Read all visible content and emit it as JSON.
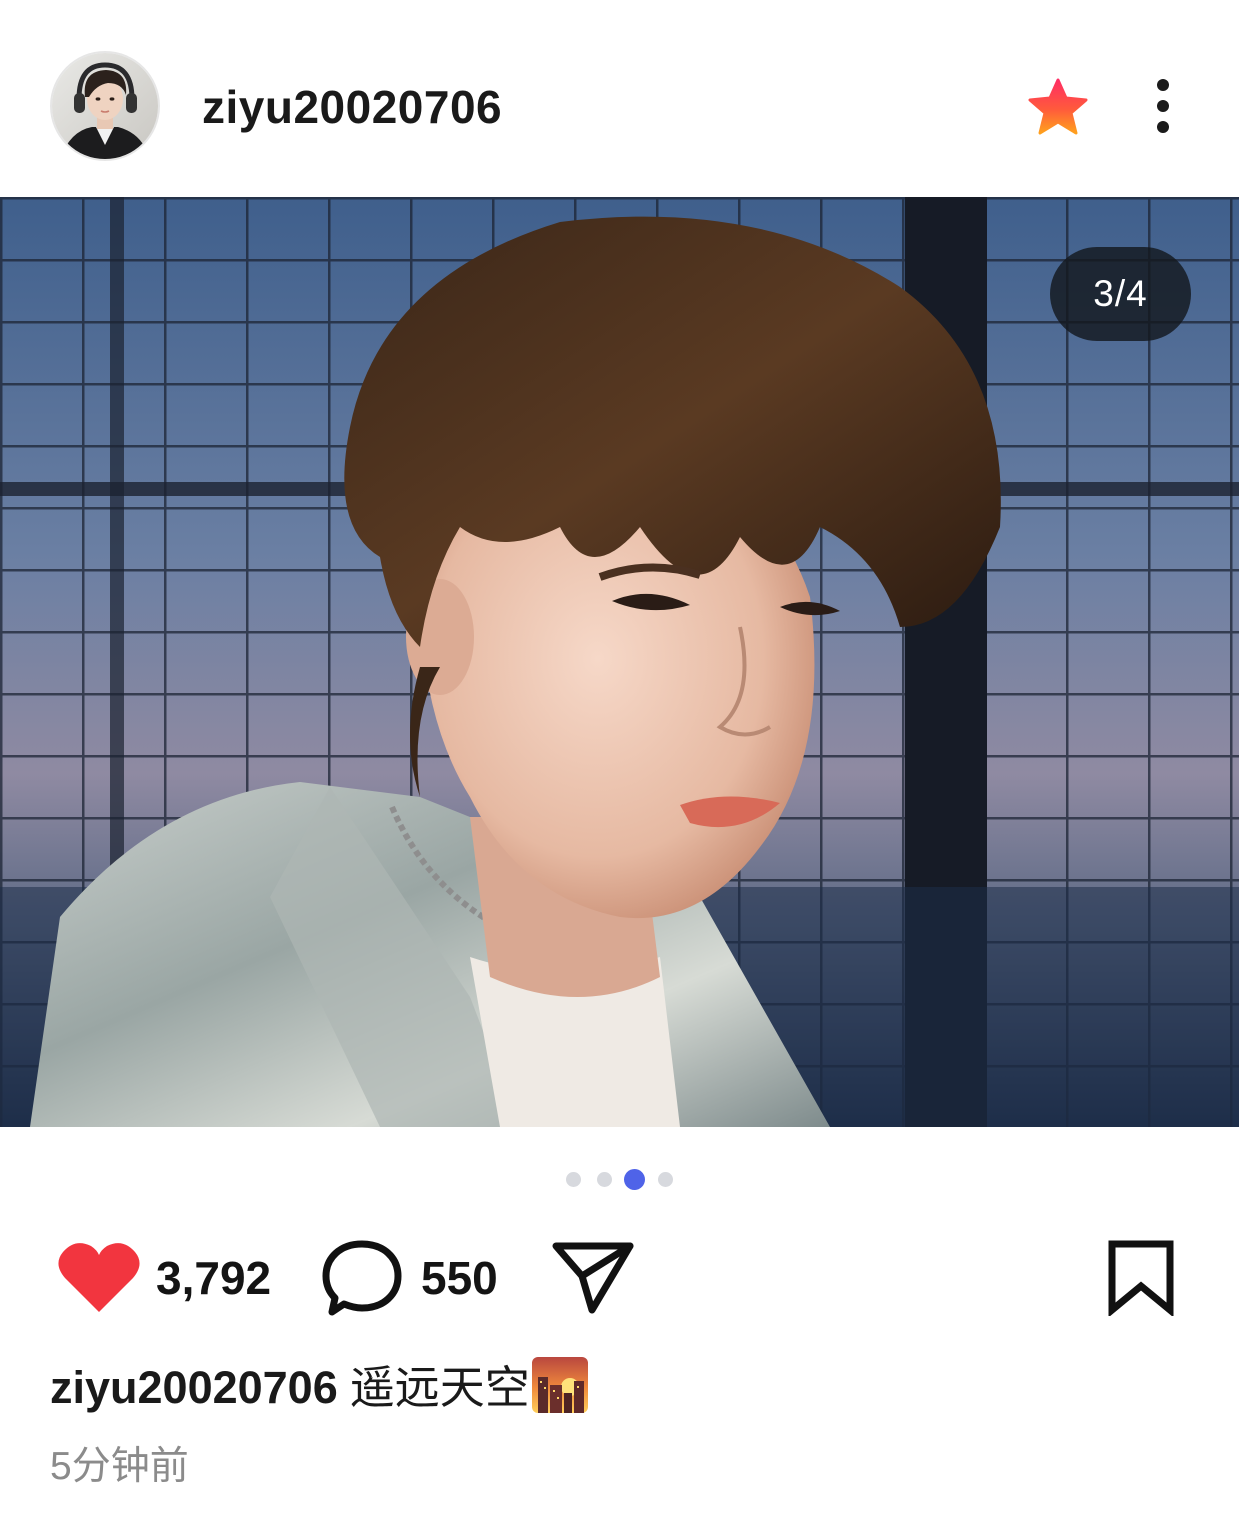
{
  "post": {
    "author": {
      "username": "ziyu20020706",
      "avatar_icon": "profile-avatar"
    },
    "header_actions": {
      "star_icon": "star-icon",
      "more_icon": "more-vertical-icon"
    },
    "image": {
      "counter": "3/4",
      "current_index": 3,
      "total": 4
    },
    "stats": {
      "likes": "3,792",
      "comments": "550",
      "like_icon": "heart-icon",
      "comment_icon": "comment-bubble-icon",
      "share_icon": "send-icon",
      "bookmark_icon": "bookmark-icon"
    },
    "caption": {
      "author": "ziyu20020706",
      "text": "遥远天空",
      "emoji_icon": "sunset-cityscape-emoji"
    },
    "timestamp": "5分钟前"
  },
  "colors": {
    "like_red": "#f2353f",
    "active_dot": "#4f63e8",
    "inactive_dot": "#d7d9de",
    "star_gradient_top": "#ff3b5c",
    "star_gradient_bottom": "#ff9a1f",
    "time_gray": "#8b8b8b"
  }
}
